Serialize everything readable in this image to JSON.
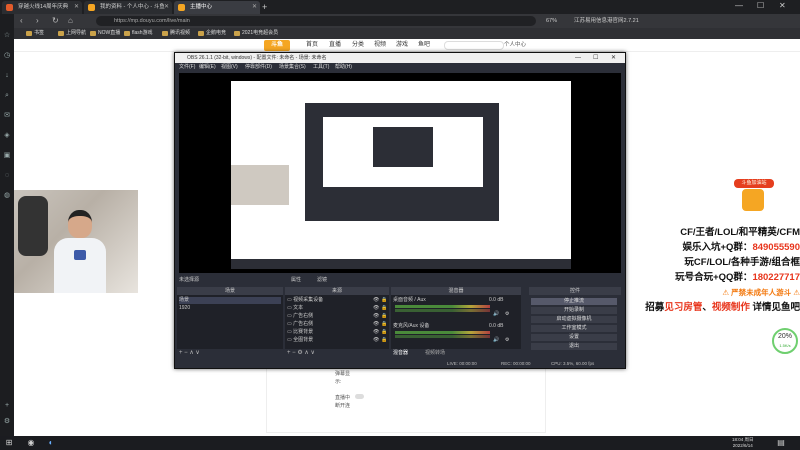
{
  "browser": {
    "tabs": [
      {
        "label": "穿越火线14周年庆典",
        "color": "#e25b2b"
      },
      {
        "label": "我的资料 - 个人中心 - 斗鱼",
        "color": "#f5a623"
      },
      {
        "label": "主播中心",
        "color": "#f5a623"
      }
    ],
    "url": "https://mp.douyu.com/live/main",
    "zoom": "67%",
    "right_info": "江苏易用信息港官网2.7.21"
  },
  "bookmarks": [
    "书签",
    "上网导航",
    "NOW直播",
    "flash游戏",
    "腾讯视频",
    "企鹅电竞",
    "2021电竞超会员"
  ],
  "site": {
    "logo": "斗鱼",
    "nav": [
      "首页",
      "直播",
      "分类",
      "视频",
      "游戏",
      "鱼吧"
    ],
    "user": "个人中心"
  },
  "obs": {
    "title": "OBS 26.1.1 (32-bit, windows) - 配置文件: 未命名 - 场景: 未命名",
    "menu": [
      "文件(F)",
      "编辑(E)",
      "视图(V)",
      "停靠部件(D)",
      "场景集合(S)",
      "工具(T)",
      "帮助(H)"
    ],
    "scene_bar": {
      "label": "未选择源",
      "props": "属性",
      "filters": "滤镜"
    },
    "scenes_header": "场景",
    "scenes": [
      "场景",
      "1920"
    ],
    "sources_header": "来源",
    "sources": [
      "视频采集设备",
      "文本",
      "广告右侧",
      "广告右侧",
      "比赛背景",
      "全图背景"
    ],
    "mixer_header": "混音器",
    "mixer": [
      {
        "name": "桌面音频 / Aux",
        "db": "0.0 dB"
      },
      {
        "name": "麦克风/Aux 设备",
        "db": "0.0 dB"
      }
    ],
    "mixer_tabs": [
      "混音器",
      "视频转场"
    ],
    "controls_header": "控件",
    "controls": [
      "停止推流",
      "开始录制",
      "启动虚拟摄像机",
      "工作室模式",
      "设置",
      "退出"
    ],
    "status": {
      "live": "LIVE: 00:00:00",
      "rec": "REC: 00:00:00",
      "cpu": "CPU: 3.5%, 60.00 fps"
    }
  },
  "promo": {
    "badge": "斗鱼加油站",
    "lines": [
      {
        "parts": [
          {
            "t": "CF/王者/LOL/和平精英/CFM",
            "c": ""
          }
        ]
      },
      {
        "parts": [
          {
            "t": "娱乐入坑+Q群：",
            "c": ""
          },
          {
            "t": "849055590",
            "c": "red"
          }
        ]
      },
      {
        "parts": [
          {
            "t": "玩CF/LOL/各种手游/组合框",
            "c": ""
          }
        ]
      },
      {
        "parts": [
          {
            "t": "玩号合玩+QQ群：",
            "c": ""
          },
          {
            "t": "180227717",
            "c": "red"
          }
        ]
      },
      {
        "parts": [
          {
            "t": "⚠ 严禁未成年人游斗 ⚠",
            "c": "orange"
          }
        ],
        "small": true
      },
      {
        "parts": [
          {
            "t": "招募",
            "c": ""
          },
          {
            "t": "见习房管",
            "c": "red"
          },
          {
            "t": "、",
            "c": ""
          },
          {
            "t": "视频制作",
            "c": "red"
          },
          {
            "t": " 详情见鱼吧",
            "c": ""
          }
        ]
      }
    ]
  },
  "speed": {
    "value": "20%",
    "sub": "1.5K/s"
  },
  "page_bottom": [
    "弹幕显",
    "示:",
    "直播中",
    "断开连"
  ],
  "taskbar": {
    "time": "18:04 周日",
    "date": "2022/6/14"
  }
}
